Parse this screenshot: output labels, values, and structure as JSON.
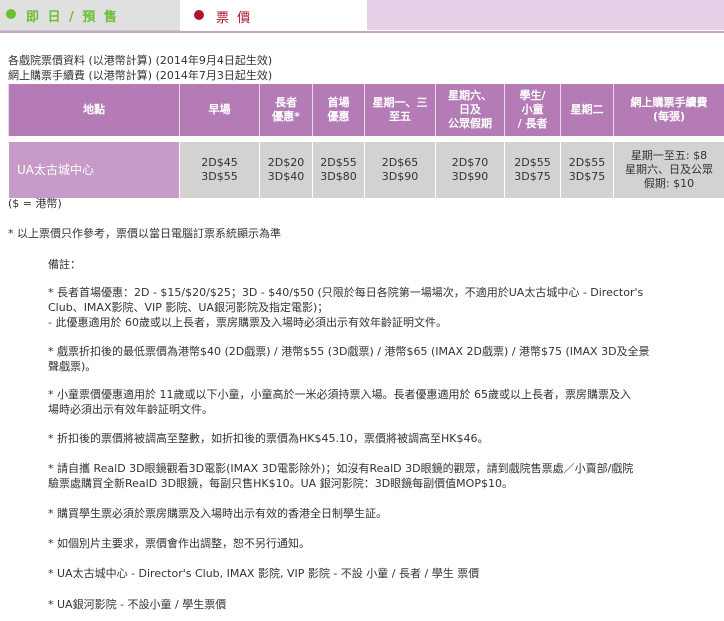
{
  "tabs": {
    "booking": "即 日 / 預 售",
    "price": "票 價"
  },
  "info": {
    "line1": "各戲院票價資料 (以港幣計算) (2014年9月4日起生效)",
    "line2": "網上購票手續費 (以港幣計算) (2014年7月3日起生效)"
  },
  "table": {
    "headers": [
      "地點",
      "早場",
      "長者\n優惠*",
      "首場\n優惠",
      "星期一、三\n至五",
      "星期六、\n日及\n公眾假期",
      "學生/\n小童\n/ 長者",
      "星期二",
      "網上購票手續費\n(每張)"
    ],
    "rows": [
      {
        "name": "UA太古城中心",
        "cells": [
          "2D$45\n3D$55",
          "2D$20\n3D$40",
          "2D$55\n3D$80",
          "2D$65\n3D$90",
          "2D$70\n3D$90",
          "2D$55\n3D$75",
          "2D$55\n3D$75",
          "星期一至五: $8\n星期六、日及公眾\n假期: $10"
        ]
      }
    ]
  },
  "currency_note": "($ = 港幣)",
  "disclaimer": "* 以上票價只作參考，票價以當日電腦訂票系統顯示為準",
  "remarks_title": "備註：",
  "remarks": [
    "* 長者首場優惠：2D - $15/$20/$25；3D - $40/$50 (只限於每日各院第一場場次，不適用於UA太古城中心 - Director's\nClub、IMAX影院、VIP 影院、UA銀河影院及指定電影)；\n   - 此優惠適用於 60歲或以上長者，票房購票及入場時必須出示有效年齡証明文件。",
    "* 戲票折扣後的最低票價為港幣$40 (2D戲票) / 港幣$55 (3D戲票) / 港幣$65 (IMAX 2D戲票) / 港幣$75 (IMAX 3D及全景\n聲戲票)。",
    "* 小童票價優惠適用於 11歲或以下小童，小童高於一米必須持票入場。長者優惠適用於 65歲或以上長者，票房購票及入\n場時必須出示有效年齡証明文件。",
    "* 折扣後的票價將被調高至整數，如折扣後的票價為HK$45.10，票價將被調高至HK$46。",
    "* 請自攜 RealD 3D眼鏡觀看3D電影(IMAX 3D電影除外)；如沒有RealD 3D眼鏡的觀眾，請到戲院售票處／小賣部/戲院\n驗票處購買全新RealD 3D眼鏡，每副只售HK$10。UA 銀河影院：3D眼鏡每副價值MOP$10。",
    "* 購買學生票必須於票房購票及入場時出示有效的香港全日制學生証。",
    "* 如個別片主要求，票價會作出調整，恕不另行通知。",
    "* UA太古城中心 - Director's Club, IMAX 影院, VIP 影院 - 不設 小童 / 長者 / 學生 票價",
    "* UA銀河影院 - 不設小童 / 學生票價"
  ],
  "colors": {
    "header_purple": "#b57bb6",
    "name_cell": "#c89ac8",
    "booking_green": "#6cbf34",
    "price_red": "#b0162a"
  }
}
